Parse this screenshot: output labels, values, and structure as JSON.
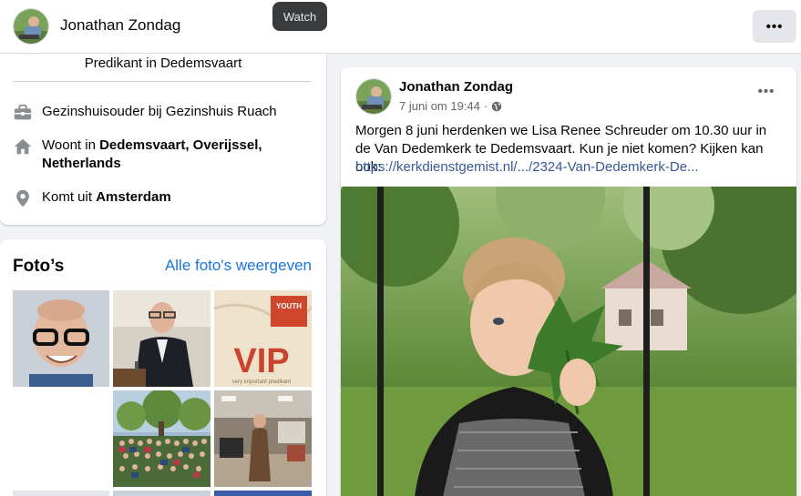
{
  "header": {
    "name": "Jonathan Zondag",
    "tooltip": "Watch",
    "more_label": "•••"
  },
  "intro": {
    "role": "Predikant in Dedemsvaart",
    "work": {
      "prefix": "Gezinshuisouder bij Gezinshuis Ruach",
      "icon": "briefcase-icon"
    },
    "lives": {
      "prefix": "Woont in ",
      "place_line1": "Dedemsvaart, Overijssel,",
      "place_line2": "Netherlands",
      "icon": "home-icon"
    },
    "from": {
      "prefix": "Komt uit ",
      "place": "Amsterdam",
      "icon": "location-pin-icon"
    }
  },
  "photos": {
    "title": "Foto’s",
    "see_all": "Alle foto's weergeven",
    "vip_text": "VIP",
    "vip_subtitle": "very important predikant",
    "youth_text": "YOUTH"
  },
  "post": {
    "author": "Jonathan Zondag",
    "date": "7 juni om 19:44",
    "dot": "·",
    "more_label": "•••",
    "text": "Morgen 8 juni herdenken we Lisa Renee Schreuder om 10.30 uur in de Van Dedemkerk te Dedemsvaart. Kun je niet komen? Kijken kan ook:",
    "link": "https://kerkdienstgemist.nl/.../2324-Van-Dedemkerk-De..."
  },
  "colors": {
    "link_blue": "#1b74e4",
    "post_link": "#385898",
    "tooltip_bg": "#3a3b3c",
    "icon_gray": "#8a8d91"
  }
}
